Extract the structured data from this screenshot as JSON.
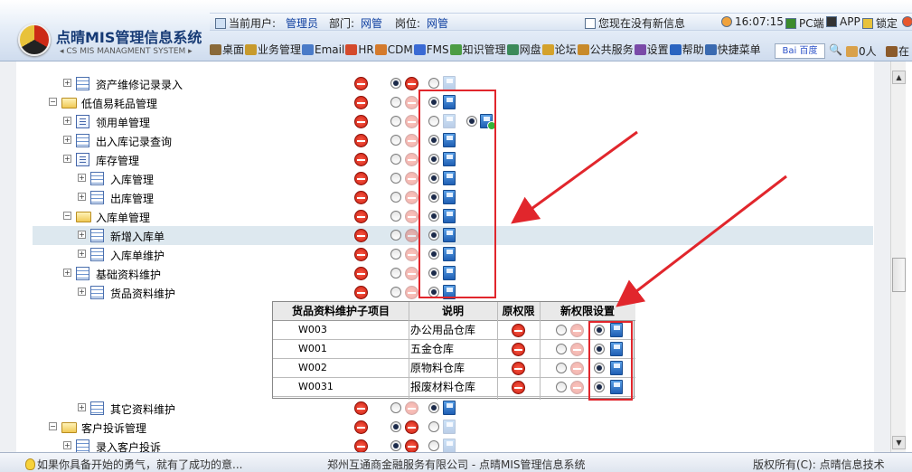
{
  "header": {
    "logo_title": "点晴MIS管理信息系统",
    "logo_subtitle": "◂ CS MIS MANAGMENT SYSTEM ▸",
    "current_user_label": "当前用户:",
    "current_user_value": "管理员",
    "dept_label": "部门:",
    "dept_value": "网管",
    "post_label": "岗位:",
    "post_value": "网管",
    "message_text": "您现在没有新信息",
    "clock": "16:07:15",
    "pc_label": "PC端",
    "app_label": "APP",
    "lock_label": "锁定"
  },
  "menu": {
    "items": [
      "桌面",
      "业务管理",
      "Email",
      "HR",
      "CDM",
      "FMS",
      "知识管理",
      "网盘",
      "论坛",
      "公共服务",
      "设置",
      "帮助",
      "快捷菜单"
    ],
    "search_logo": "Bai 百度",
    "online_count": "0人",
    "more_label": "在"
  },
  "tree": {
    "rows": [
      {
        "label": "资产维修记录录入",
        "indent": 2,
        "icon": "grid",
        "deny": true,
        "radio1": true,
        "deny2": true,
        "radio2": false,
        "grant": "faint"
      },
      {
        "label": "低值易耗品管理",
        "indent": 1,
        "icon": "folder",
        "deny": true,
        "radio1": false,
        "deny2": true,
        "radio2": true,
        "grant": "on"
      },
      {
        "label": "领用单管理",
        "indent": 2,
        "icon": "page",
        "deny": true,
        "radio1": false,
        "deny2": true,
        "radio2": false,
        "grant": "faint",
        "extra": true
      },
      {
        "label": "出入库记录查询",
        "indent": 2,
        "icon": "grid",
        "deny": true,
        "radio1": false,
        "deny2": true,
        "radio2": true,
        "grant": "on"
      },
      {
        "label": "库存管理",
        "indent": 2,
        "icon": "page",
        "deny": true,
        "radio1": false,
        "deny2": true,
        "radio2": true,
        "grant": "on"
      },
      {
        "label": "入库管理",
        "indent": 3,
        "icon": "grid",
        "deny": true,
        "radio1": false,
        "deny2": true,
        "radio2": true,
        "grant": "on"
      },
      {
        "label": "出库管理",
        "indent": 3,
        "icon": "grid",
        "deny": true,
        "radio1": false,
        "deny2": true,
        "radio2": true,
        "grant": "on"
      },
      {
        "label": "入库单管理",
        "indent": 2,
        "icon": "folder",
        "deny": true,
        "radio1": false,
        "deny2": true,
        "radio2": true,
        "grant": "on"
      },
      {
        "label": "新增入库单",
        "indent": 3,
        "icon": "grid",
        "deny": true,
        "radio1": false,
        "deny2": true,
        "radio2": true,
        "grant": "on",
        "highlight": true
      },
      {
        "label": "入库单维护",
        "indent": 3,
        "icon": "grid",
        "deny": true,
        "radio1": false,
        "deny2": true,
        "radio2": true,
        "grant": "on"
      },
      {
        "label": "基础资料维护",
        "indent": 2,
        "icon": "grid",
        "deny": true,
        "radio1": false,
        "deny2": true,
        "radio2": true,
        "grant": "on"
      },
      {
        "label": "货品资料维护",
        "indent": 3,
        "icon": "grid",
        "deny": true,
        "radio1": false,
        "deny2": true,
        "radio2": true,
        "grant": "on"
      },
      {
        "label": "其它资料维护",
        "indent": 3,
        "icon": "grid",
        "deny": true,
        "radio1": false,
        "deny2": true,
        "radio2": true,
        "grant": "on"
      },
      {
        "label": "客户投诉管理",
        "indent": 1,
        "icon": "folder",
        "deny": true,
        "radio1": true,
        "deny2": true,
        "radio2": false,
        "grant": "faint"
      },
      {
        "label": "录入客户投诉",
        "indent": 2,
        "icon": "grid",
        "deny": true,
        "radio1": true,
        "deny2": true,
        "radio2": false,
        "grant": "faint"
      }
    ]
  },
  "popup": {
    "headers": [
      "货品资料维护子项目",
      "说明",
      "原权限",
      "新权限设置"
    ],
    "rows": [
      {
        "code": "W003",
        "desc": "办公用品仓库"
      },
      {
        "code": "W001",
        "desc": "五金仓库"
      },
      {
        "code": "W002",
        "desc": "原物料仓库"
      },
      {
        "code": "W0031",
        "desc": "报废材料仓库"
      }
    ]
  },
  "status": {
    "motto": "如果你具备开始的勇气，就有了成功的意...",
    "company": "郑州互通商金融服务有限公司 - 点晴MIS管理信息系统",
    "copyright": "版权所有(C): 点晴信息技术"
  },
  "annotation_color": "#e1262c"
}
